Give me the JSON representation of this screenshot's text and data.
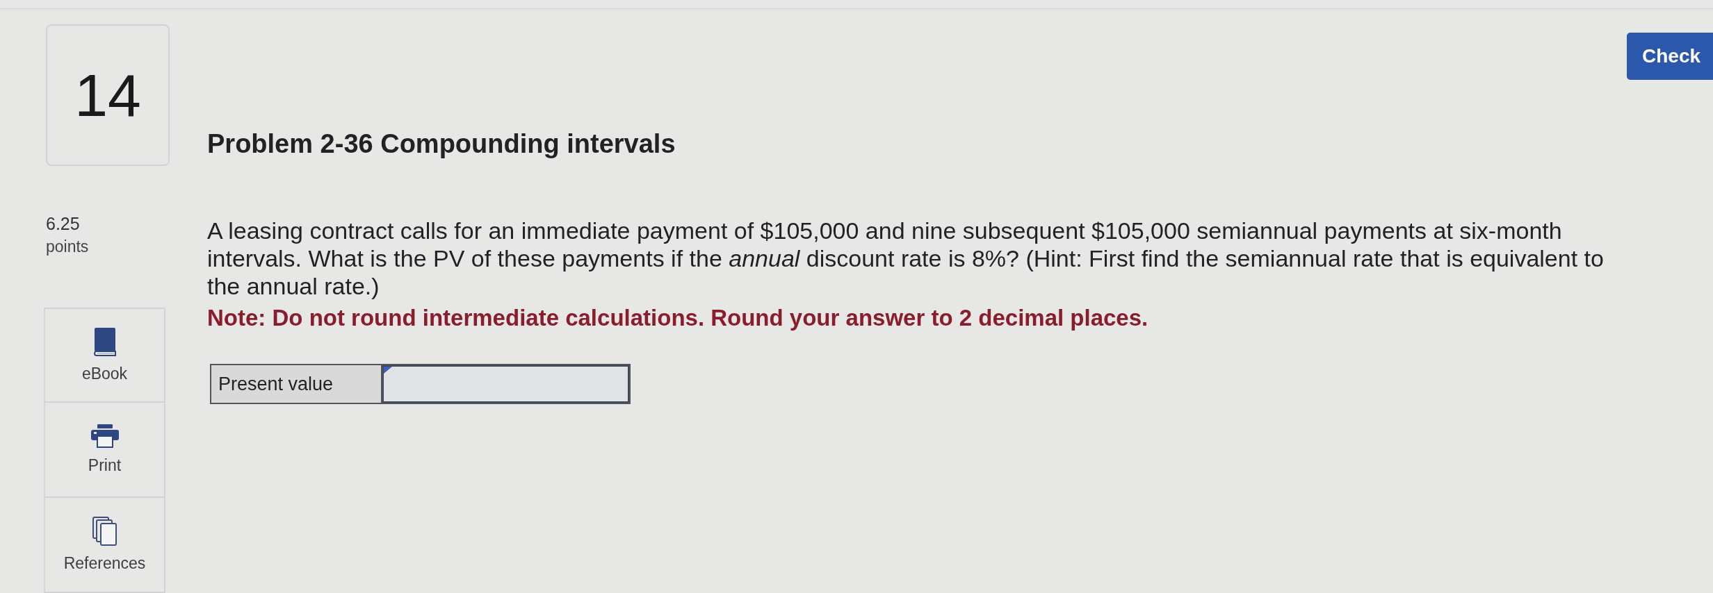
{
  "header": {
    "check_button": "Check"
  },
  "question": {
    "number": "14",
    "points_value": "6.25",
    "points_label": "points"
  },
  "tools": [
    {
      "kind": "book",
      "label": "eBook"
    },
    {
      "kind": "print",
      "label": "Print"
    },
    {
      "kind": "references",
      "label": "References"
    }
  ],
  "problem": {
    "title": "Problem 2-36 Compounding intervals",
    "text": "A leasing contract calls for an immediate payment of $105,000 and nine subsequent $105,000 semiannual payments at six-month intervals. What is the PV of these payments if the *annual* discount rate is 8%? (Hint: First find the semiannual rate that is equivalent to the annual rate.)",
    "note": "Note: Do not round intermediate calculations. Round your answer to 2 decimal places."
  },
  "answer_table": {
    "rows": [
      {
        "label": "Present value"
      }
    ]
  }
}
